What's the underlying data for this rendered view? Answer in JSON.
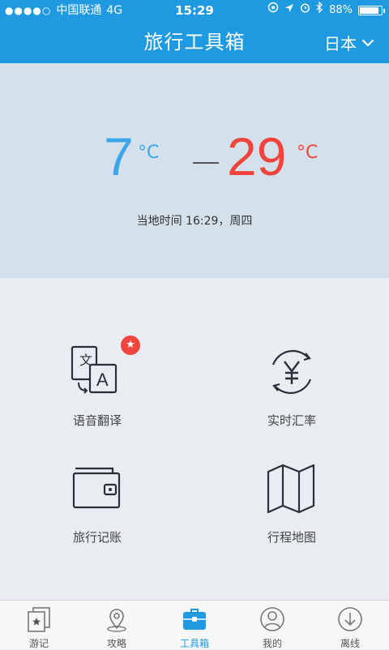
{
  "status_bar": {
    "signal_dots": "●●●●○",
    "carrier": "中国联通",
    "network": "4G",
    "time": "15:29",
    "battery_percent": "88%",
    "battery_level": 0.88
  },
  "header": {
    "title": "旅行工具箱",
    "country": "日本"
  },
  "weather": {
    "low": "7",
    "low_unit": "°C",
    "high": "29",
    "high_unit": "°C",
    "local_time": "当地时间 16:29，周四"
  },
  "tools": {
    "translate": {
      "label": "语音翻译",
      "badge": "★"
    },
    "exchange": {
      "label": "实时汇率"
    },
    "expense": {
      "label": "旅行记账"
    },
    "itinerary": {
      "label": "行程地图"
    }
  },
  "tabs": [
    {
      "label": "游记",
      "icon": "notes-star-icon"
    },
    {
      "label": "攻略",
      "icon": "map-pin-icon"
    },
    {
      "label": "工具箱",
      "icon": "toolbox-icon",
      "active": true
    },
    {
      "label": "我的",
      "icon": "user-icon"
    },
    {
      "label": "离线",
      "icon": "download-icon"
    }
  ],
  "colors": {
    "brand_blue": "#1f9ae0",
    "low_temp": "#3aa6e8",
    "high_temp": "#f0453c",
    "weather_bg": "#d4e0ea",
    "body_bg": "#e9edf1"
  }
}
